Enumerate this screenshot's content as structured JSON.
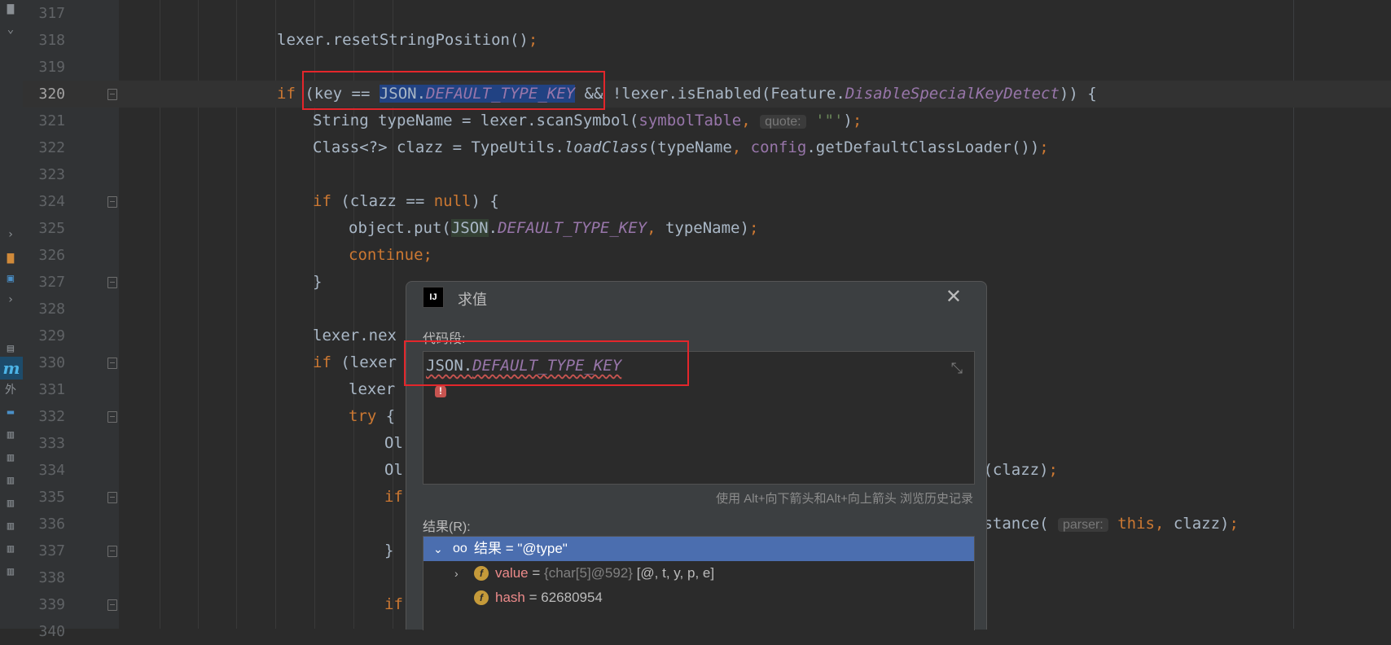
{
  "editor": {
    "lines": [
      {
        "num": "317",
        "code": ""
      },
      {
        "num": "318",
        "code": "lexer.resetStringPosition();"
      },
      {
        "num": "319",
        "code": ""
      },
      {
        "num": "320",
        "code": "if (key == JSON.DEFAULT_TYPE_KEY && !lexer.isEnabled(Feature.DisableSpecialKeyDetect)) {"
      },
      {
        "num": "321",
        "code": "String typeName = lexer.scanSymbol(symbolTable, quote: '\"');"
      },
      {
        "num": "322",
        "code": "Class<?> clazz = TypeUtils.loadClass(typeName, config.getDefaultClassLoader());"
      },
      {
        "num": "323",
        "code": ""
      },
      {
        "num": "324",
        "code": "if (clazz == null) {"
      },
      {
        "num": "325",
        "code": "object.put(JSON.DEFAULT_TYPE_KEY, typeName);"
      },
      {
        "num": "326",
        "code": "continue;"
      },
      {
        "num": "327",
        "code": "}"
      },
      {
        "num": "328",
        "code": ""
      },
      {
        "num": "329",
        "code": "lexer.nex"
      },
      {
        "num": "330",
        "code": "if (lexer"
      },
      {
        "num": "331",
        "code": "lexer"
      },
      {
        "num": "332",
        "code": "try {"
      },
      {
        "num": "333",
        "code": "Ol"
      },
      {
        "num": "334",
        "code": "Ol ...r(clazz);"
      },
      {
        "num": "335",
        "code": "if"
      },
      {
        "num": "336",
        "code": "...nstance( parser: this, clazz);"
      },
      {
        "num": "337",
        "code": "}"
      },
      {
        "num": "338",
        "code": ""
      },
      {
        "num": "339",
        "code": "if"
      },
      {
        "num": "340",
        "code": ""
      }
    ],
    "hint_quote": "quote:",
    "hint_parser": "parser:"
  },
  "dialog": {
    "title": "求值",
    "code_label": "代码段:",
    "expression_obj": "JSON.",
    "expression_field": "DEFAULT_TYPE_KEY",
    "history_hint": "使用 Alt+向下箭头和Alt+向上箭头 浏览历史记录",
    "result_label": "结果(R):",
    "result_root": "结果 = \"@type\"",
    "fields": [
      {
        "name": "value",
        "type": "{char[5]@592}",
        "value": "[@, t, y, p, e]"
      },
      {
        "name": "hash",
        "type": "",
        "value": "62680954"
      }
    ]
  },
  "leftbar": {
    "label_wai": "外",
    "m_label": "m"
  }
}
